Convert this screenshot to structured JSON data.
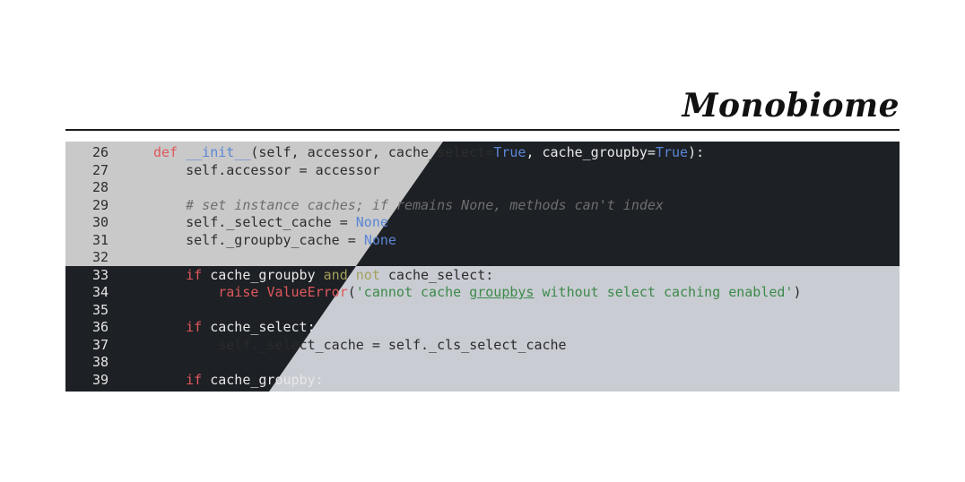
{
  "header": {
    "title": "Monobiome"
  },
  "code": {
    "lines": [
      {
        "n": "26",
        "text": "    def __init__(self, accessor, cache_select=True, cache_groupby=True):"
      },
      {
        "n": "27",
        "text": "        self.accessor = accessor"
      },
      {
        "n": "28",
        "text": ""
      },
      {
        "n": "29",
        "text": "        # set instance caches; if remains None, methods can't index"
      },
      {
        "n": "30",
        "text": "        self._select_cache = None"
      },
      {
        "n": "31",
        "text": "        self._groupby_cache = None"
      },
      {
        "n": "32",
        "text": ""
      },
      {
        "n": "33",
        "text": "        if cache_groupby and not cache_select:"
      },
      {
        "n": "34",
        "text": "            raise ValueError('cannot cache groupbys without select caching enabled')"
      },
      {
        "n": "35",
        "text": ""
      },
      {
        "n": "36",
        "text": "        if cache_select:"
      },
      {
        "n": "37",
        "text": "            self._select_cache = self._cls_select_cache"
      },
      {
        "n": "38",
        "text": ""
      },
      {
        "n": "39",
        "text": "        if cache_groupby:"
      }
    ],
    "tokens": {
      "l26_def": "def",
      "l26_fn": "__init__",
      "l26_a": "(self, accessor, cache_select=",
      "l26_true1": "True",
      "l26_b": ", cache_groupby=",
      "l26_true2": "True",
      "l26_c": "):",
      "l27": "self.accessor = accessor",
      "l29": "# set instance caches; if remains None, methods can't index",
      "l30_a": "self._select_cache = ",
      "l30_none": "None",
      "l31_a": "self._groupby_cache = ",
      "l31_none": "None",
      "l33_if": "if",
      "l33_a": " cache_groupby ",
      "l33_and": "and",
      "l33_sp": " ",
      "l33_not": "not",
      "l33_b": " cache_select:",
      "l34_raise": "raise",
      "l34_sp": " ",
      "l34_err": "ValueError",
      "l34_p": "(",
      "l34_s1": "'cannot cache ",
      "l34_s2": "groupbys",
      "l34_s3": " without select caching enabled'",
      "l34_close": ")",
      "l36_if": "if",
      "l36_a": " cache_select:",
      "l37": "self._select_cache = self._cls_select_cache",
      "l39_if": "if",
      "l39_a": " cache_groupby:"
    }
  },
  "colors": {
    "light_bg": "#c9c9c9",
    "light_bg_bottom": "#c9ccd3",
    "dark_bg": "#1d2024",
    "keyword": "#e0585c",
    "builtin": "#5b86d6",
    "string": "#3d8a4a",
    "comment": "#6e6e6e"
  }
}
